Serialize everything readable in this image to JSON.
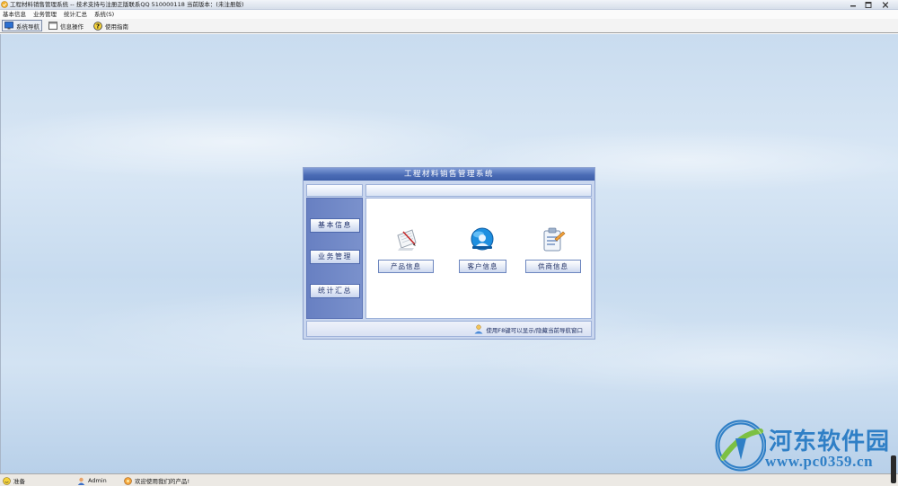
{
  "window": {
    "title": "工程材料销售管理系统 -- 技术支持与注册正版联系QQ 510000118    当前版本：(未注册版)",
    "controls": [
      "minimize-icon",
      "maximize-icon",
      "close-icon"
    ]
  },
  "menu": [
    "基本信息",
    "业务管理",
    "统计汇总",
    "系统(S)"
  ],
  "toolbar": [
    {
      "label": "系统导航",
      "icon": "monitor-icon",
      "pressed": true
    },
    {
      "label": "信息操作",
      "icon": "window-icon",
      "pressed": false
    },
    {
      "label": "使用指南",
      "icon": "help-icon",
      "pressed": false
    }
  ],
  "dialog": {
    "title": "工程材料销售管理系统",
    "nav": [
      "基本信息",
      "业务管理",
      "统计汇总"
    ],
    "items": [
      {
        "label": "产品信息",
        "icon": "document-pen-icon"
      },
      {
        "label": "客户信息",
        "icon": "globe-person-icon"
      },
      {
        "label": "供商信息",
        "icon": "clipboard-icon"
      }
    ],
    "hint": "使用F8键可以显示/隐藏当前导航窗口"
  },
  "status": {
    "state": "准备",
    "user": "Admin",
    "message": "欢迎使用我们的产品!"
  },
  "watermark": {
    "name": "河东软件园",
    "url": "www.pc0359.cn"
  },
  "colors": {
    "dialog_title": "#4b6cb6",
    "nav_panel": "#6f87c6",
    "watermark": "#2f7fc6"
  }
}
